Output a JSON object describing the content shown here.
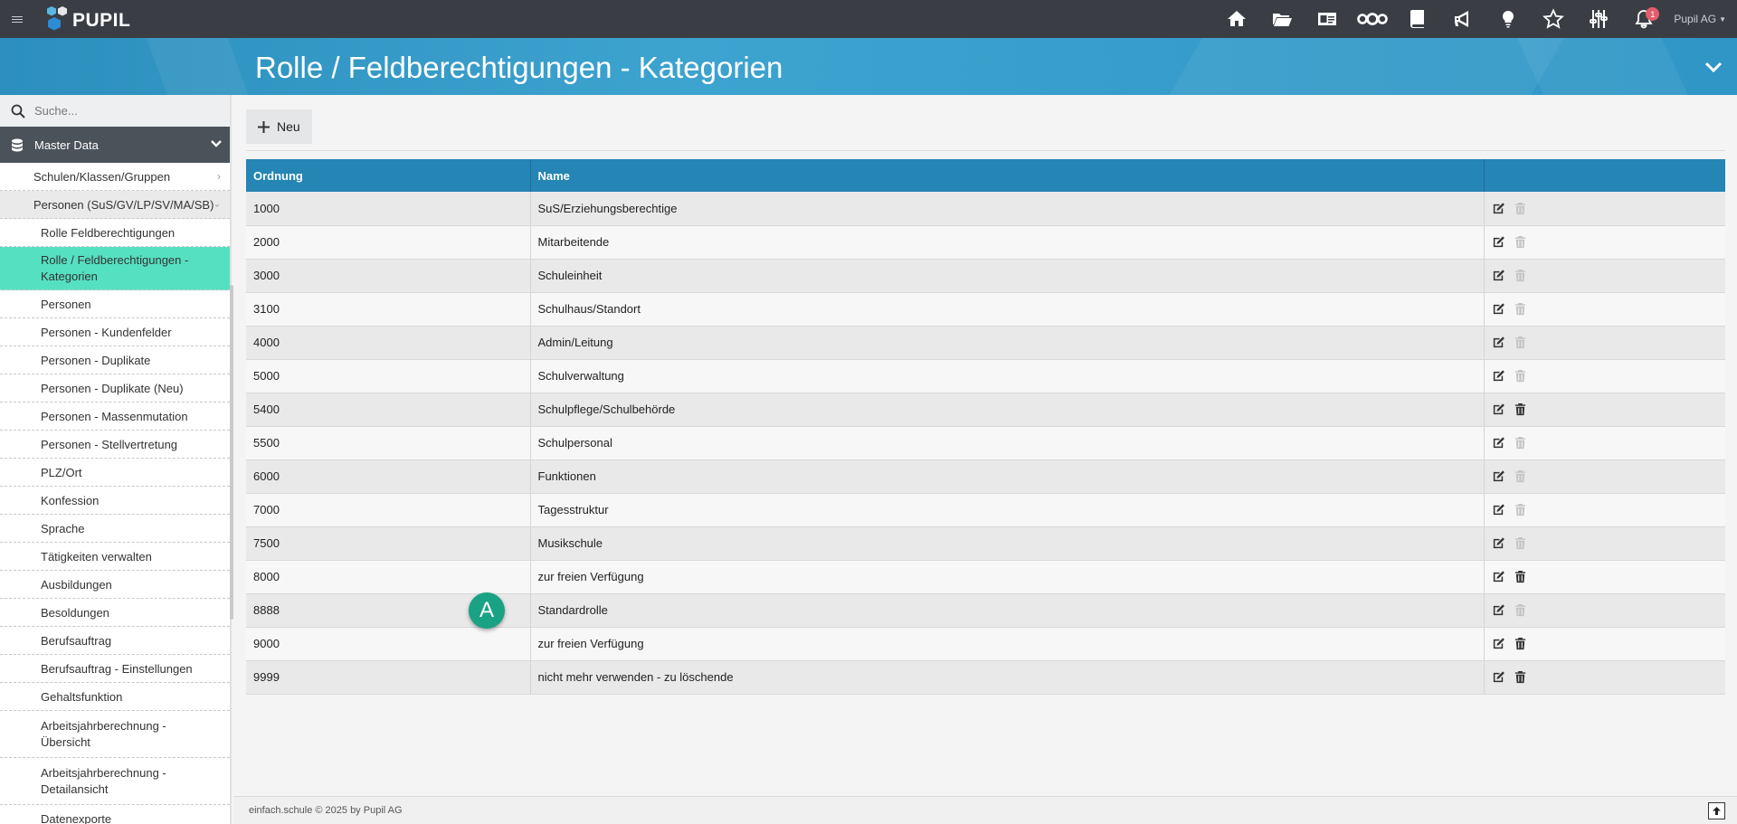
{
  "app": {
    "logo_text": "PUPIL",
    "user_label": "Pupil AG",
    "notification_count": "1"
  },
  "top_icons": [
    "home-icon",
    "folder-open-icon",
    "id-card-icon",
    "network-icon",
    "book-icon",
    "megaphone-icon",
    "lightbulb-icon",
    "star-icon",
    "sliders-icon",
    "bell-icon"
  ],
  "page": {
    "title": "Rolle / Feldberechtigungen - Kategorien"
  },
  "sidebar": {
    "search_placeholder": "Suche...",
    "section": "Master Data",
    "items": [
      {
        "label": "Schulen/Klassen/Gruppen"
      },
      {
        "label": "Personen (SuS/GV/LP/SV/MA/SB)"
      },
      {
        "label": "Rolle Feldberechtigungen"
      },
      {
        "label": "Rolle / Feldberechtigungen -",
        "label2": "Kategorien"
      },
      {
        "label": "Personen"
      },
      {
        "label": "Personen - Kundenfelder"
      },
      {
        "label": "Personen - Duplikate"
      },
      {
        "label": "Personen - Duplikate (Neu)"
      },
      {
        "label": "Personen - Massenmutation"
      },
      {
        "label": "Personen - Stellvertretung"
      },
      {
        "label": "PLZ/Ort"
      },
      {
        "label": "Konfession"
      },
      {
        "label": "Sprache"
      },
      {
        "label": "Tätigkeiten verwalten"
      },
      {
        "label": "Ausbildungen"
      },
      {
        "label": "Besoldungen"
      },
      {
        "label": "Berufsauftrag"
      },
      {
        "label": "Berufsauftrag - Einstellungen"
      },
      {
        "label": "Gehaltsfunktion"
      },
      {
        "label": "Arbeitsjahrberechnung -",
        "label2": "Übersicht"
      },
      {
        "label": "Arbeitsjahrberechnung -",
        "label2": "Detailansicht"
      },
      {
        "label": "Datenexporte"
      }
    ]
  },
  "toolbar": {
    "new_label": "Neu"
  },
  "table": {
    "headers": [
      "Ordnung",
      "Name",
      ""
    ],
    "rows": [
      {
        "order": "1000",
        "name": "SuS/Erziehungsberechtige",
        "delete_enabled": false
      },
      {
        "order": "2000",
        "name": "Mitarbeitende",
        "delete_enabled": false
      },
      {
        "order": "3000",
        "name": "Schuleinheit",
        "delete_enabled": false
      },
      {
        "order": "3100",
        "name": "Schulhaus/Standort",
        "delete_enabled": false
      },
      {
        "order": "4000",
        "name": "Admin/Leitung",
        "delete_enabled": false
      },
      {
        "order": "5000",
        "name": "Schulverwaltung",
        "delete_enabled": false
      },
      {
        "order": "5400",
        "name": "Schulpflege/Schulbehörde",
        "delete_enabled": true
      },
      {
        "order": "5500",
        "name": "Schulpersonal",
        "delete_enabled": false
      },
      {
        "order": "6000",
        "name": "Funktionen",
        "delete_enabled": false
      },
      {
        "order": "7000",
        "name": "Tagesstruktur",
        "delete_enabled": false
      },
      {
        "order": "7500",
        "name": "Musikschule",
        "delete_enabled": false
      },
      {
        "order": "8000",
        "name": "zur freien Verfügung",
        "delete_enabled": true
      },
      {
        "order": "8888",
        "name": "Standardrolle",
        "delete_enabled": false
      },
      {
        "order": "9000",
        "name": "zur freien Verfügung",
        "delete_enabled": true
      },
      {
        "order": "9999",
        "name": "nicht mehr verwenden - zu löschende",
        "delete_enabled": true
      }
    ]
  },
  "marker": {
    "label": "A"
  },
  "footer": {
    "text": "einfach.schule © 2025 by Pupil AG"
  },
  "colors": {
    "topbar": "#3a3e44",
    "banner": "#2f96c6",
    "table_header": "#2585b4",
    "active_item": "#56e0c2",
    "marker": "#1aa284"
  }
}
